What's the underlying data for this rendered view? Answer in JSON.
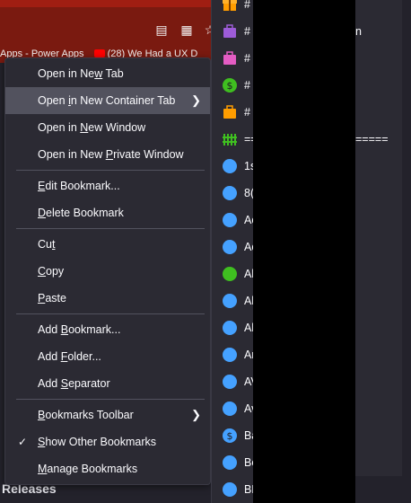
{
  "bookmarks_bar": {
    "item1": "Apps - Power Apps",
    "item2": "(28) We Had a UX D"
  },
  "background": {
    "releases": "Releases"
  },
  "context_menu": {
    "items": [
      {
        "pre": "Open in Ne",
        "key": "w",
        "post": " Tab"
      },
      {
        "pre": "Open ",
        "key": "i",
        "post": "n New Container Tab"
      },
      {
        "pre": "Open in ",
        "key": "N",
        "post": "ew Window"
      },
      {
        "pre": "Open in New ",
        "key": "P",
        "post": "rivate Window"
      },
      {
        "pre": "",
        "key": "E",
        "post": "dit Bookmark..."
      },
      {
        "pre": "",
        "key": "D",
        "post": "elete Bookmark"
      },
      {
        "pre": "Cu",
        "key": "t",
        "post": ""
      },
      {
        "pre": "",
        "key": "C",
        "post": "opy"
      },
      {
        "pre": "",
        "key": "P",
        "post": "aste"
      },
      {
        "pre": "Add ",
        "key": "B",
        "post": "ookmark..."
      },
      {
        "pre": "Add ",
        "key": "F",
        "post": "older..."
      },
      {
        "pre": "Add ",
        "key": "S",
        "post": "eparator"
      },
      {
        "pre": "",
        "key": "B",
        "post": "ookmarks Toolbar"
      },
      {
        "pre": "",
        "key": "S",
        "post": "how Other Bookmarks"
      },
      {
        "pre": "",
        "key": "M",
        "post": "anage Bookmarks"
      }
    ]
  },
  "bookmark_list": {
    "items": [
      {
        "label": "#",
        "icon": "gift-icon"
      },
      {
        "label": "#",
        "icon": "briefcase-purple-icon"
      },
      {
        "label": "#",
        "icon": "briefcase-pink-icon"
      },
      {
        "label": "#",
        "icon": "dollar-green-icon"
      },
      {
        "label": "#",
        "icon": "briefcase-orange-icon"
      },
      {
        "label": "==",
        "icon": "fence-icon"
      },
      {
        "label": "1s",
        "icon": "circle-blue-icon"
      },
      {
        "label": "8(",
        "icon": "circle-blue-icon"
      },
      {
        "label": "Ac",
        "icon": "circle-blue-icon"
      },
      {
        "label": "Ac",
        "icon": "circle-blue-icon"
      },
      {
        "label": "Al",
        "icon": "circle-green-icon"
      },
      {
        "label": "Al",
        "icon": "circle-blue-icon"
      },
      {
        "label": "Al",
        "icon": "circle-blue-icon"
      },
      {
        "label": "Ar",
        "icon": "circle-blue-icon"
      },
      {
        "label": "AV",
        "icon": "circle-blue-icon"
      },
      {
        "label": "Av",
        "icon": "circle-blue-icon"
      },
      {
        "label": "Ba",
        "icon": "dollar-blue-icon"
      },
      {
        "label": "Be",
        "icon": "circle-blue-icon"
      },
      {
        "label": "BE",
        "icon": "circle-blue-icon"
      }
    ],
    "right_fragment_top": "n",
    "right_fragment_sep": "====="
  },
  "colors": {
    "accent_blue": "#45a1ff",
    "green": "#3fbf20",
    "purple": "#9d5cd8",
    "pink": "#e45cc3",
    "orange": "#ff9d00"
  }
}
